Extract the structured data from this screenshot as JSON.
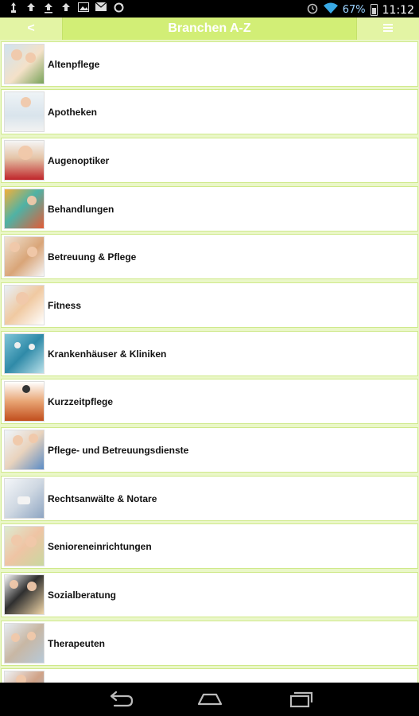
{
  "status_bar": {
    "battery_percent": "67%",
    "time": "11:12",
    "left_icons": [
      "usb-icon",
      "upload-icon",
      "upload-icon",
      "upload-icon",
      "image-icon",
      "mail-icon",
      "sync-icon"
    ],
    "right_icons": [
      "alarm-icon",
      "wifi-icon",
      "battery-icon"
    ]
  },
  "header": {
    "back_label": "<",
    "title": "Branchen A-Z",
    "menu_icon": "menu-icon"
  },
  "list": {
    "items": [
      {
        "label": "Altenpflege",
        "thumb": "t-a"
      },
      {
        "label": "Apotheken",
        "thumb": "t-b"
      },
      {
        "label": "Augenoptiker",
        "thumb": "t-c"
      },
      {
        "label": "Behandlungen",
        "thumb": "t-d"
      },
      {
        "label": "Betreuung & Pflege",
        "thumb": "t-e"
      },
      {
        "label": "Fitness",
        "thumb": "t-f"
      },
      {
        "label": "Krankenhäuser & Kliniken",
        "thumb": "t-g"
      },
      {
        "label": "Kurzzeitpflege",
        "thumb": "t-h"
      },
      {
        "label": "Pflege- und Betreuungsdienste",
        "thumb": "t-i"
      },
      {
        "label": "Rechtsanwälte & Notare",
        "thumb": "t-j"
      },
      {
        "label": "Senioreneinrichtungen",
        "thumb": "t-k"
      },
      {
        "label": "Sozialberatung",
        "thumb": "t-l"
      },
      {
        "label": "Therapeuten",
        "thumb": "t-m"
      },
      {
        "label": "",
        "thumb": "t-n"
      }
    ]
  },
  "nav_bar": {
    "icons": [
      "back-icon",
      "home-icon",
      "recent-apps-icon"
    ]
  }
}
